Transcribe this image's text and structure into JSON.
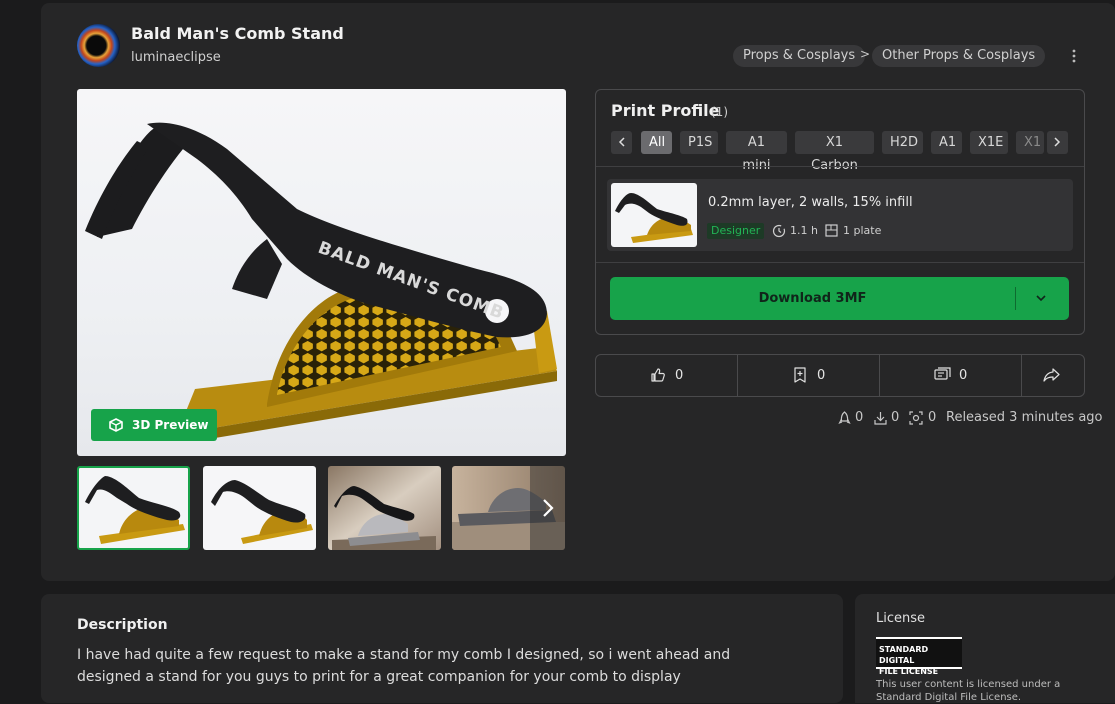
{
  "header": {
    "title": "Bald Man's Comb Stand",
    "author": "luminaeclipse",
    "breadcrumb": [
      "Props & Cosplays",
      "Other Props & Cosplays"
    ],
    "breadcrumb_separator": ">"
  },
  "gallery": {
    "preview_button_label": "3D Preview",
    "hero_model_text": "BALD MAN'S COMB",
    "thumbnail_count": 4,
    "selected_thumbnail": 1
  },
  "print_profile": {
    "title": "Print Profile",
    "count": "(1)",
    "printer_filters": [
      "All",
      "P1S",
      "A1 mini",
      "X1 Carbon",
      "H2D",
      "A1",
      "X1E",
      "X1"
    ],
    "active_filter": "All",
    "profile": {
      "description": "0.2mm layer, 2 walls, 15% infill",
      "badge": "Designer",
      "print_time": "1.1 h",
      "plates": "1 plate"
    },
    "download_label": "Download 3MF"
  },
  "stats": {
    "likes": "0",
    "collects": "0",
    "comments": "0",
    "boosts": "0",
    "downloads": "0",
    "prints": "0",
    "released": "Released 3 minutes ago"
  },
  "description": {
    "title": "Description",
    "text": "I have had quite a few request to make a stand for my comb I designed, so i went ahead and designed a stand for you guys to print for a great companion for your comb to display"
  },
  "license": {
    "title": "License",
    "badge_line1": "STANDARD DIGITAL",
    "badge_line2": "FILE LICENSE",
    "text": "This user content is licensed under a Standard Digital File License."
  },
  "colors": {
    "accent_green": "#17a34a",
    "card_bg": "#262627",
    "page_bg": "#1b1b1c",
    "model_gold": "#c99a12",
    "model_black": "#1c1c1e"
  }
}
